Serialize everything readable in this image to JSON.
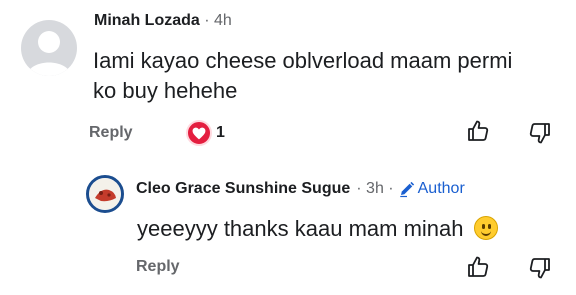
{
  "comments": [
    {
      "author": "Minah Lozada",
      "time": "· 4h",
      "text_line1": "Iami kayao cheese oblverload maam permi",
      "text_line2": "ko buy hehehe",
      "reply_label": "Reply",
      "reaction_count": "1",
      "reaction_icon": "heart-icon"
    },
    {
      "author": "Cleo Grace Sunshine Sugue",
      "time": "· 3h ·",
      "author_tag": "Author",
      "text": "yeeeyyy thanks kaau mam minah",
      "emoji_icon": "smiling-face-icon",
      "reply_label": "Reply"
    }
  ],
  "colors": {
    "reaction_heart": "#e41e3f",
    "author_tag": "#1a5fd0",
    "muted_text": "#65676b"
  }
}
